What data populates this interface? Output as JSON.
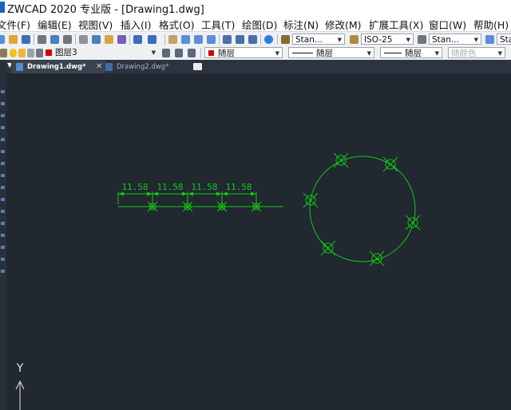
{
  "title": "ZWCAD 2020 专业版 - [Drawing1.dwg]",
  "menu": [
    "文件(F)",
    "编辑(E)",
    "视图(V)",
    "插入(I)",
    "格式(O)",
    "工具(T)",
    "绘图(D)",
    "标注(N)",
    "修改(M)",
    "扩展工具(X)",
    "窗口(W)",
    "帮助(H)"
  ],
  "toolbar": {
    "text_style": "Stan...",
    "dim_style": "ISO-25",
    "table_style": "Stan...",
    "layer": "图层3",
    "color": "随层",
    "linetype": "随层",
    "lineweight": "随层",
    "plot_style": "随颜色"
  },
  "tabs": [
    {
      "label": "Drawing1.dwg*",
      "active": true
    },
    {
      "label": "Drawing2.dwg*",
      "active": false
    }
  ],
  "drawing": {
    "dimension_value": "11.58",
    "ucs_y_label": "Y",
    "entity_color": "#14c814"
  },
  "colors": {
    "canvas_background": "#212830",
    "layer_color_swatch": "#d40000"
  }
}
